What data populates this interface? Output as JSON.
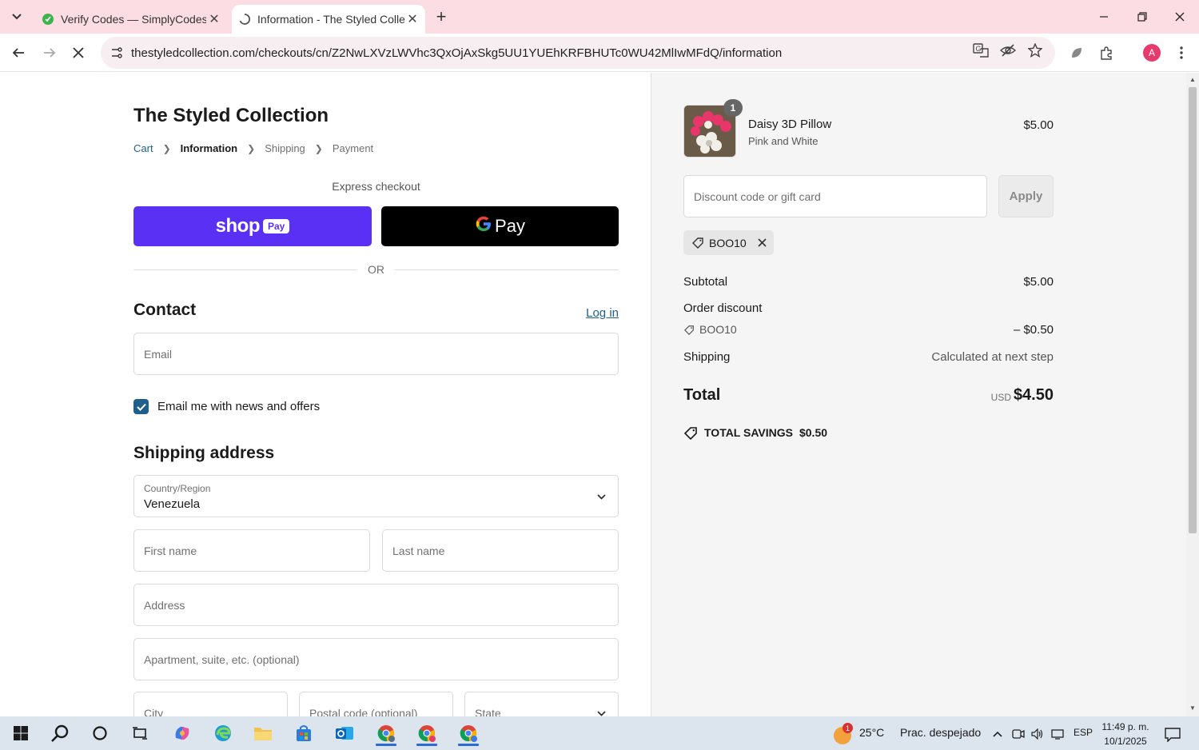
{
  "browser": {
    "tabs": [
      {
        "title": "Verify Codes — SimplyCodes",
        "favicon": "simplycodes-leaf-icon",
        "active": false
      },
      {
        "title": "Information - The Styled Collection",
        "favicon": "loading-spinner-icon",
        "active": true
      }
    ],
    "url": "thestyledcollection.com/checkouts/cn/Z2NwLXVzLWVhc3QxOjAxSkg5UU1YUEhKRFBHUTc0WU42MlIwMFdQ/information",
    "profile_initial": "A",
    "accent_color": "#fbdde3"
  },
  "checkout": {
    "store_name": "The Styled Collection",
    "breadcrumb": [
      "Cart",
      "Information",
      "Shipping",
      "Payment"
    ],
    "express_label": "Express checkout",
    "shop_pay": {
      "word": "shop",
      "badge": "Pay",
      "color": "#5a31f4"
    },
    "gpay": {
      "g": "G",
      "word": "Pay"
    },
    "or_text": "OR",
    "contact": {
      "heading": "Contact",
      "login_link": "Log in",
      "email_placeholder": "Email",
      "newsletter_label": "Email me with news and offers",
      "newsletter_checked": true
    },
    "shipping": {
      "heading": "Shipping address",
      "country_label": "Country/Region",
      "country_value": "Venezuela",
      "first_name_placeholder": "First name",
      "last_name_placeholder": "Last name",
      "address_placeholder": "Address",
      "apartment_placeholder": "Apartment, suite, etc. (optional)",
      "city_placeholder": "City",
      "postal_placeholder": "Postal code (optional)",
      "state_placeholder": "State"
    }
  },
  "summary": {
    "product": {
      "name": "Daisy 3D Pillow",
      "variant": "Pink and White",
      "price": "$5.00",
      "quantity": "1"
    },
    "discount_placeholder": "Discount code or gift card",
    "apply_label": "Apply",
    "applied_code": "BOO10",
    "subtotal_label": "Subtotal",
    "subtotal_value": "$5.00",
    "order_discount_label": "Order discount",
    "discount_code": "BOO10",
    "discount_value": "– $0.50",
    "shipping_label": "Shipping",
    "shipping_value": "Calculated at next step",
    "total_label": "Total",
    "total_currency": "USD",
    "total_value": "$4.50",
    "savings_label": "TOTAL SAVINGS",
    "savings_value": "$0.50"
  },
  "taskbar": {
    "temperature": "25°C",
    "weather": "Prac. despejado",
    "weather_badge": "1",
    "language": "ESP",
    "time": "11:49 p. m.",
    "date": "10/1/2025"
  }
}
